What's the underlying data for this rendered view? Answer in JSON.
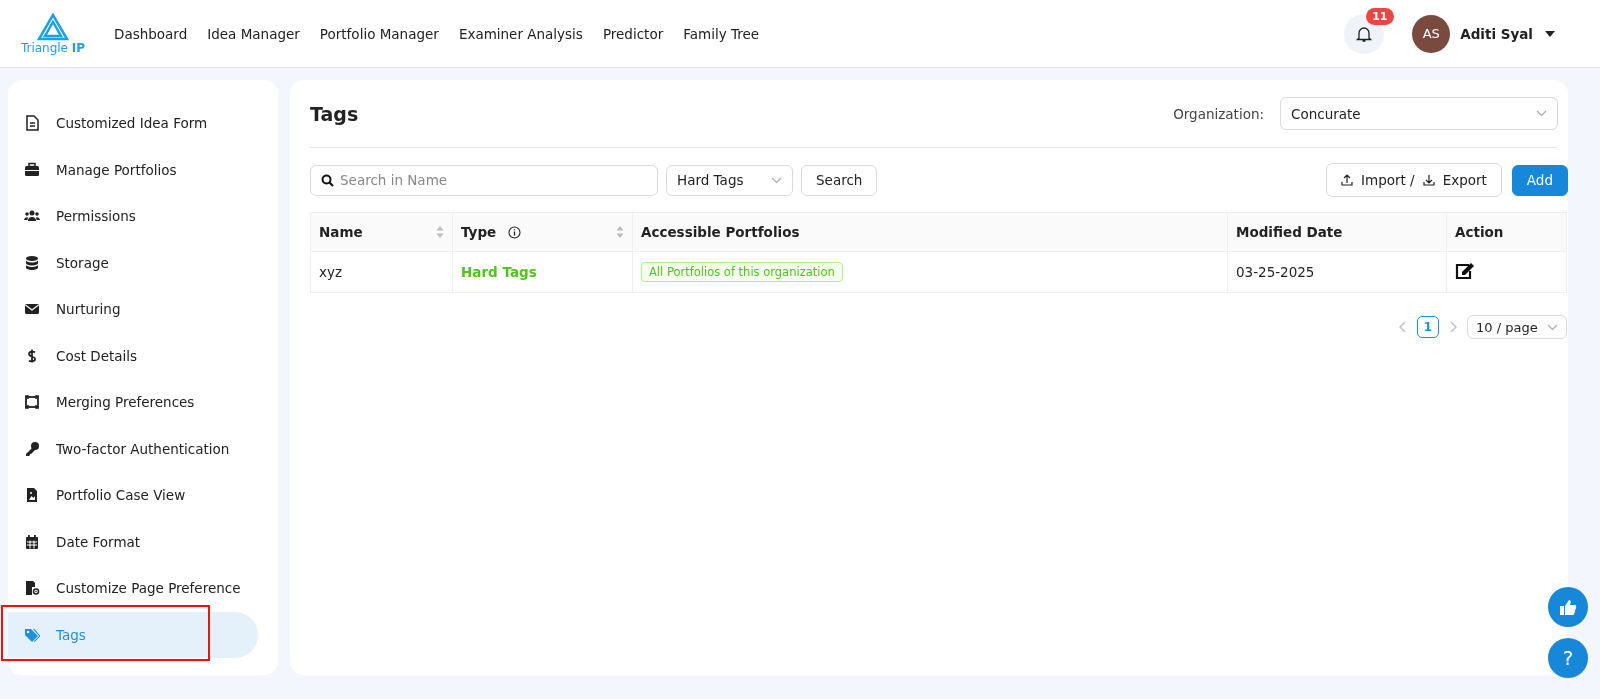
{
  "brand": {
    "name": "Triangle",
    "suffix": "IP"
  },
  "nav": [
    {
      "label": "Dashboard"
    },
    {
      "label": "Idea Manager"
    },
    {
      "label": "Portfolio Manager"
    },
    {
      "label": "Examiner Analysis"
    },
    {
      "label": "Predictor"
    },
    {
      "label": "Family Tree"
    }
  ],
  "notifications": {
    "count": "11"
  },
  "user": {
    "initials": "AS",
    "name": "Aditi Syal"
  },
  "sidebar": {
    "items": [
      {
        "label": "Customized Idea Form",
        "selected": false,
        "annotated": false
      },
      {
        "label": "Manage Portfolios",
        "selected": false,
        "annotated": false
      },
      {
        "label": "Permissions",
        "selected": false,
        "annotated": false
      },
      {
        "label": "Storage",
        "selected": false,
        "annotated": false
      },
      {
        "label": "Nurturing",
        "selected": false,
        "annotated": false
      },
      {
        "label": "Cost Details",
        "selected": false,
        "annotated": false
      },
      {
        "label": "Merging Preferences",
        "selected": false,
        "annotated": false
      },
      {
        "label": "Two-factor Authentication",
        "selected": false,
        "annotated": false
      },
      {
        "label": "Portfolio Case View",
        "selected": false,
        "annotated": false
      },
      {
        "label": "Date Format",
        "selected": false,
        "annotated": false
      },
      {
        "label": "Customize Page Preference",
        "selected": false,
        "annotated": false
      },
      {
        "label": "Tags",
        "selected": true,
        "annotated": true
      }
    ]
  },
  "page": {
    "title": "Tags",
    "organization": {
      "label": "Organization:",
      "value": "Concurate"
    }
  },
  "toolbar": {
    "search": {
      "placeholder": "Search in Name"
    },
    "type_filter": "Hard Tags",
    "search_button": "Search",
    "import": "Import /",
    "export": "Export",
    "add": "Add"
  },
  "table": {
    "columns": [
      {
        "label": "Name",
        "sortable": true,
        "info": false
      },
      {
        "label": "Type",
        "sortable": true,
        "info": true
      },
      {
        "label": "Accessible Portfolios",
        "sortable": false,
        "info": false
      },
      {
        "label": "Modified Date",
        "sortable": false,
        "info": false
      },
      {
        "label": "Action",
        "sortable": false,
        "info": false
      }
    ],
    "rows": [
      {
        "name": "xyz",
        "type": "Hard Tags",
        "portfolios": "All Portfolios of this organization",
        "modified": "03-25-2025"
      }
    ]
  },
  "pagination": {
    "pages": [
      {
        "label": "1",
        "selected": true
      }
    ],
    "page_size": "10 / page"
  },
  "help_button": {
    "label": "?"
  }
}
